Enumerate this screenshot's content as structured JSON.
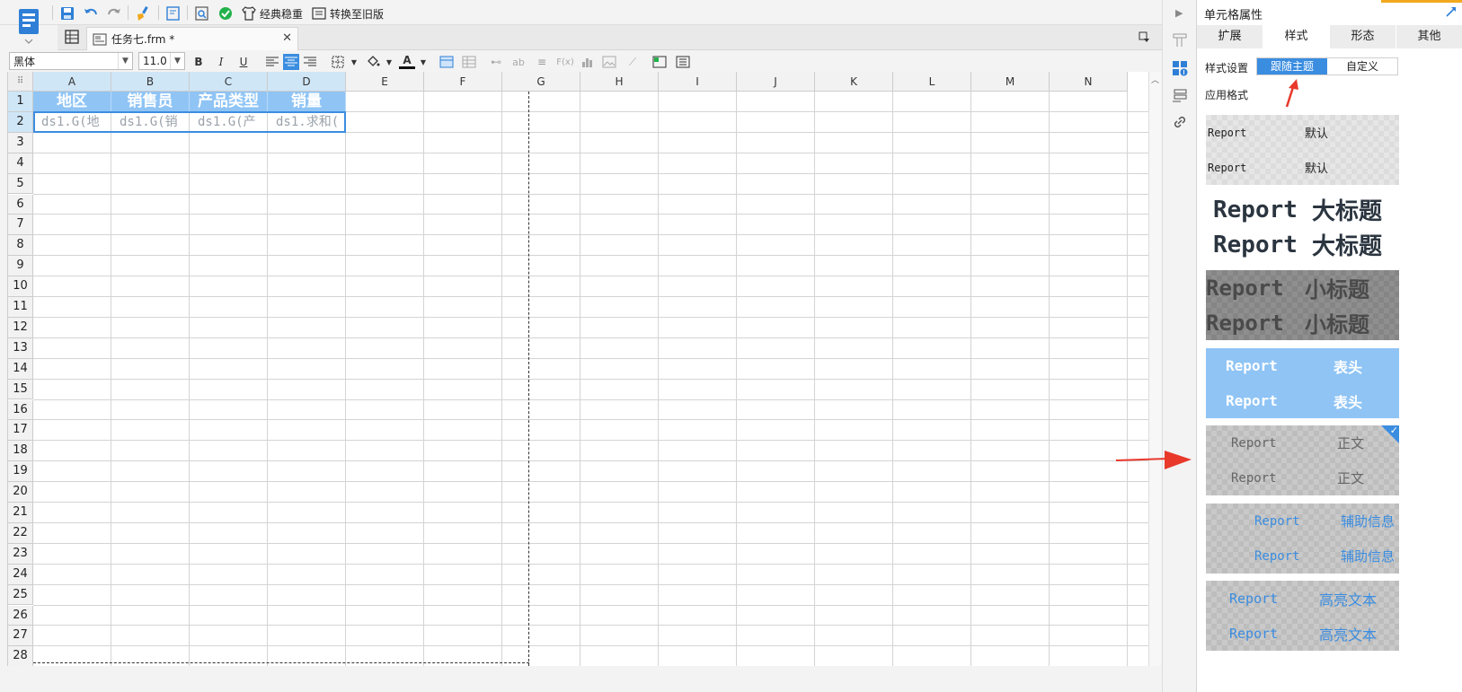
{
  "toolbar": {
    "classic_label": "经典稳重",
    "convert_label": "转换至旧版",
    "icons": [
      "save-icon",
      "undo-icon",
      "redo-icon",
      "format-brush-icon",
      "preview-icon",
      "search-preview-icon",
      "check-icon"
    ]
  },
  "file_tab": {
    "name": "任务七.frm *"
  },
  "format_bar": {
    "font_name": "黑体",
    "font_size": "11.0",
    "bold": "B",
    "italic": "I",
    "underline": "U",
    "font_color_letter": "A",
    "ab_label": "ab",
    "fx_label": "F(x)"
  },
  "grid": {
    "columns": [
      "A",
      "B",
      "C",
      "D",
      "E",
      "F",
      "G",
      "H",
      "I",
      "J",
      "K",
      "L",
      "M",
      "N"
    ],
    "rows": [
      "1",
      "2",
      "3",
      "4",
      "5",
      "6",
      "7",
      "8",
      "9",
      "10",
      "11",
      "12",
      "13",
      "14",
      "15",
      "16",
      "17",
      "18",
      "19",
      "20",
      "21",
      "22",
      "23",
      "24",
      "25",
      "26",
      "27",
      "28"
    ],
    "header_cells": [
      "地区",
      "销售员",
      "产品类型",
      "销量"
    ],
    "data_cells": [
      "ds1.G(地",
      "ds1.G(销",
      "ds1.G(产",
      "ds1.求和("
    ]
  },
  "panel": {
    "title": "单元格属性",
    "tabs": [
      "扩展",
      "样式",
      "形态",
      "其他"
    ],
    "active_tab": "样式",
    "style_setting_label": "样式设置",
    "style_options": [
      "跟随主题",
      "自定义"
    ],
    "selected_option": "跟随主题",
    "apply_format_label": "应用格式",
    "styles": [
      {
        "en": "Report",
        "cn": "默认"
      },
      {
        "en": "Report",
        "cn": "大标题"
      },
      {
        "en": "Report",
        "cn": "小标题"
      },
      {
        "en": "Report",
        "cn": "表头"
      },
      {
        "en": "Report",
        "cn": "正文"
      },
      {
        "en": "Report",
        "cn": "辅助信息"
      },
      {
        "en": "Report",
        "cn": "高亮文本"
      }
    ],
    "selected_style": "正文"
  },
  "colors": {
    "accent": "#3b8de0",
    "header_fill": "#8fc4f5",
    "arrow": "#e8392b"
  }
}
